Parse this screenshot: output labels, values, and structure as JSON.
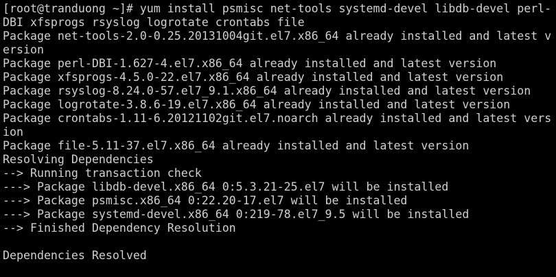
{
  "terminal": {
    "background": "#000000",
    "foreground": "#d0d0d0",
    "lines": [
      "[root@tranduong ~]# yum install psmisc net-tools systemd-devel libdb-devel perl-",
      "DBI xfsprogs rsyslog logrotate crontabs file",
      "Package net-tools-2.0-0.25.20131004git.el7.x86_64 already installed and latest v",
      "ersion",
      "Package perl-DBI-1.627-4.el7.x86_64 already installed and latest version",
      "Package xfsprogs-4.5.0-22.el7.x86_64 already installed and latest version",
      "Package rsyslog-8.24.0-57.el7_9.1.x86_64 already installed and latest version",
      "Package logrotate-3.8.6-19.el7.x86_64 already installed and latest version",
      "Package crontabs-1.11-6.20121102git.el7.noarch already installed and latest vers",
      "ion",
      "Package file-5.11-37.el7.x86_64 already installed and latest version",
      "Resolving Dependencies",
      "--> Running transaction check",
      "---> Package libdb-devel.x86_64 0:5.3.21-25.el7 will be installed",
      "---> Package psmisc.x86_64 0:22.20-17.el7 will be installed",
      "---> Package systemd-devel.x86_64 0:219-78.el7_9.5 will be installed",
      "--> Finished Dependency Resolution",
      "",
      "Dependencies Resolved"
    ]
  }
}
